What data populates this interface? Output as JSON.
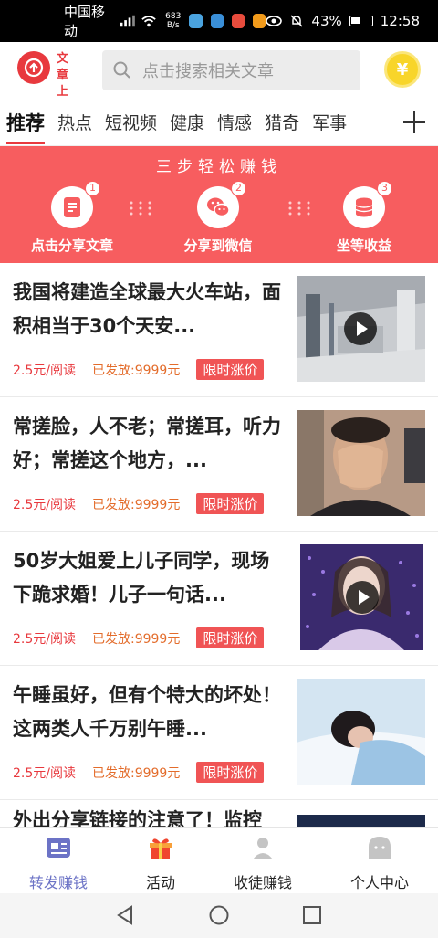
{
  "status_bar": {
    "carrier": "中国移动",
    "net_speed_value": "683",
    "net_speed_unit": "B/s",
    "battery": "43%",
    "time": "12:58"
  },
  "header": {
    "logo_text": "文章上传",
    "search_placeholder": "点击搜索相关文章",
    "coin_symbol": "¥"
  },
  "tabs": [
    "推荐",
    "热点",
    "短视频",
    "健康",
    "情感",
    "猎奇",
    "军事"
  ],
  "promo": {
    "title": "三步轻松赚钱",
    "steps": [
      {
        "num": "1",
        "label": "点击分享文章",
        "icon": "document-icon"
      },
      {
        "num": "2",
        "label": "分享到微信",
        "icon": "wechat-icon"
      },
      {
        "num": "3",
        "label": "坐等收益",
        "icon": "coins-icon"
      }
    ]
  },
  "articles": [
    {
      "title": "我国将建造全球最大火车站，面积相当于30个天安...",
      "price": "2.5元/阅读",
      "paid": "已发放:9999元",
      "badge": "限时涨价",
      "video": true,
      "thumb": "train-station"
    },
    {
      "title": "常搓脸，人不老；常搓耳，听力好；常搓这个地方，...",
      "price": "2.5元/阅读",
      "paid": "已发放:9999元",
      "badge": "限时涨价",
      "video": false,
      "thumb": "man-rubbing-face"
    },
    {
      "title": "50岁大姐爱上儿子同学，现场下跪求婚！儿子一句话...",
      "price": "2.5元/阅读",
      "paid": "已发放:9999元",
      "badge": "限时涨价",
      "video": true,
      "thumb": "woman-stage"
    },
    {
      "title": "午睡虽好，但有个特大的坏处！这两类人千万别午睡...",
      "price": "2.5元/阅读",
      "paid": "已发放:9999元",
      "badge": "限时涨价",
      "video": false,
      "thumb": "sleeping-person"
    }
  ],
  "partial_article_title": "外出分享链接的注意了！监控",
  "bottom_nav": [
    {
      "label": "转发赚钱",
      "icon": "share-card-icon",
      "active": true
    },
    {
      "label": "活动",
      "icon": "gift-icon",
      "active": false
    },
    {
      "label": "收徒赚钱",
      "icon": "person-icon",
      "active": false
    },
    {
      "label": "个人中心",
      "icon": "face-icon",
      "active": false
    }
  ],
  "colors": {
    "brand_red": "#e8393e",
    "promo_bg": "#f75d5f",
    "nav_active": "#6c73c6",
    "paid_orange": "#e36c2b"
  }
}
